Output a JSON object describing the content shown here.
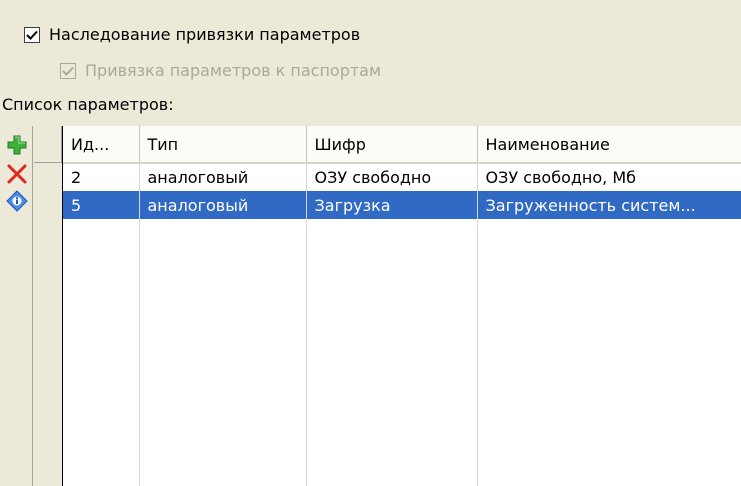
{
  "options": {
    "inherit_binding": {
      "label": "Наследование привязки параметров",
      "checked": true,
      "enabled": true
    },
    "passport_binding": {
      "label": "Привязка параметров к паспортам",
      "checked": true,
      "enabled": false
    }
  },
  "list_label": "Список параметров:",
  "toolbar": {
    "add_icon": "green-plus-icon",
    "delete_icon": "red-x-icon",
    "info_icon": "blue-info-icon"
  },
  "table": {
    "columns": [
      "Ид...",
      "Тип",
      "Шифр",
      "Наименование"
    ],
    "rows": [
      {
        "id": "2",
        "type": "аналоговый",
        "code": "ОЗУ свободно",
        "name": "ОЗУ свободно, Мб",
        "selected": false
      },
      {
        "id": "5",
        "type": "аналоговый",
        "code": "Загрузка",
        "name": "Загруженность систем...",
        "selected": true
      }
    ]
  },
  "colors": {
    "selection": "#316ac5",
    "window": "#ece9d8"
  }
}
